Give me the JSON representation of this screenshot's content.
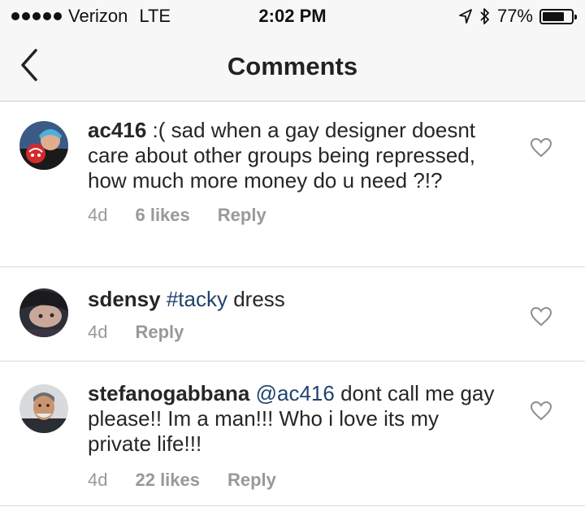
{
  "status_bar": {
    "carrier": "Verizon",
    "network": "LTE",
    "time": "2:02 PM",
    "battery": "77%",
    "battery_level": 0.77
  },
  "nav": {
    "title": "Comments"
  },
  "comments": [
    {
      "username": "ac416",
      "text": " :( sad when a gay designer doesnt care about other groups being repressed, how much more money do u need ?!?",
      "time": "4d",
      "likes": "6 likes",
      "reply_label": "Reply"
    },
    {
      "username": "sdensy",
      "hashtag": "#tacky",
      "text": " dress",
      "time": "4d",
      "reply_label": "Reply"
    },
    {
      "username": "stefanogabbana",
      "mention": "@ac416",
      "text": " dont call me gay please!! Im a man!!! Who i love its my private life!!!",
      "time": "4d",
      "likes": "22 likes",
      "reply_label": "Reply"
    }
  ],
  "colors": {
    "link": "#20436e",
    "meta": "#999999",
    "bar_background": "#f7f7f7"
  },
  "icons": [
    "signal-dots-icon",
    "location-arrow-icon",
    "bluetooth-icon",
    "battery-icon",
    "back-chevron-icon",
    "heart-outline-icon"
  ]
}
